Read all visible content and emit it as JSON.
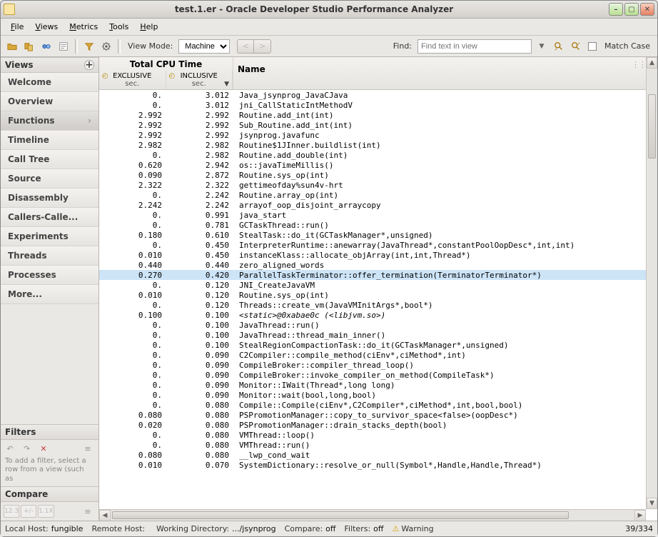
{
  "window": {
    "title": "test.1.er  -  Oracle Developer Studio Performance Analyzer"
  },
  "menu": {
    "file": "File",
    "views": "Views",
    "metrics": "Metrics",
    "tools": "Tools",
    "help": "Help"
  },
  "toolbar": {
    "view_mode_label": "View Mode:",
    "view_mode_value": "Machine",
    "find_label": "Find:",
    "find_placeholder": "Find text in view",
    "match_case_label": "Match Case"
  },
  "sidebar": {
    "views_header": "Views",
    "items": [
      {
        "label": "Welcome"
      },
      {
        "label": "Overview"
      },
      {
        "label": "Functions",
        "active": true
      },
      {
        "label": "Timeline"
      },
      {
        "label": "Call Tree"
      },
      {
        "label": "Source"
      },
      {
        "label": "Disassembly"
      },
      {
        "label": "Callers-Calle..."
      },
      {
        "label": "Experiments"
      },
      {
        "label": "Threads"
      },
      {
        "label": "Processes"
      },
      {
        "label": "More..."
      }
    ],
    "filters_header": "Filters",
    "filters_help": "To add a filter, select a row from a view (such as",
    "compare_header": "Compare"
  },
  "table": {
    "group_header": "Total CPU Time",
    "exclusive": "EXCLUSIVE",
    "inclusive": "INCLUSIVE",
    "sec": "sec.",
    "name": "Name",
    "rows": [
      {
        "ex": "0.",
        "in": "3.012",
        "fn": "Java_jsynprog_JavaCJava"
      },
      {
        "ex": "0.",
        "in": "3.012",
        "fn": "jni_CallStaticIntMethodV"
      },
      {
        "ex": "2.992",
        "in": "2.992",
        "fn": "Routine.add_int(int)"
      },
      {
        "ex": "2.992",
        "in": "2.992",
        "fn": "Sub_Routine.add_int(int)"
      },
      {
        "ex": "2.992",
        "in": "2.992",
        "fn": "jsynprog.javafunc"
      },
      {
        "ex": "2.982",
        "in": "2.982",
        "fn": "Routine$1JInner.buildlist(int)"
      },
      {
        "ex": "0.",
        "in": "2.982",
        "fn": "Routine.add_double(int)"
      },
      {
        "ex": "0.620",
        "in": "2.942",
        "fn": "os::javaTimeMillis()"
      },
      {
        "ex": "0.090",
        "in": "2.872",
        "fn": "Routine.sys_op(int)"
      },
      {
        "ex": "2.322",
        "in": "2.322",
        "fn": "gettimeofday%sun4v-hrt"
      },
      {
        "ex": "0.",
        "in": "2.242",
        "fn": "Routine.array_op(int)"
      },
      {
        "ex": "2.242",
        "in": "2.242",
        "fn": "arrayof_oop_disjoint_arraycopy"
      },
      {
        "ex": "0.",
        "in": "0.991",
        "fn": "java_start"
      },
      {
        "ex": "0.",
        "in": "0.781",
        "fn": "GCTaskThread::run()"
      },
      {
        "ex": "0.180",
        "in": "0.610",
        "fn": "StealTask::do_it(GCTaskManager*,unsigned)"
      },
      {
        "ex": "0.",
        "in": "0.450",
        "fn": "InterpreterRuntime::anewarray(JavaThread*,constantPoolOopDesc*,int,int)"
      },
      {
        "ex": "0.010",
        "in": "0.450",
        "fn": "instanceKlass::allocate_objArray(int,int,Thread*)"
      },
      {
        "ex": "0.440",
        "in": "0.440",
        "fn": "zero_aligned_words"
      },
      {
        "ex": "0.270",
        "in": "0.420",
        "fn": "ParallelTaskTerminator::offer_termination(TerminatorTerminator*)",
        "sel": true
      },
      {
        "ex": "0.",
        "in": "0.120",
        "fn": "JNI_CreateJavaVM"
      },
      {
        "ex": "0.010",
        "in": "0.120",
        "fn": "Routine.sys_op(int)"
      },
      {
        "ex": "0.",
        "in": "0.120",
        "fn": "Threads::create_vm(JavaVMInitArgs*,bool*)"
      },
      {
        "ex": "0.100",
        "in": "0.100",
        "fn": "<static>@0xabae0c (<libjvm.so>)",
        "italic": true
      },
      {
        "ex": "0.",
        "in": "0.100",
        "fn": "JavaThread::run()"
      },
      {
        "ex": "0.",
        "in": "0.100",
        "fn": "JavaThread::thread_main_inner()"
      },
      {
        "ex": "0.",
        "in": "0.100",
        "fn": "StealRegionCompactionTask::do_it(GCTaskManager*,unsigned)"
      },
      {
        "ex": "0.",
        "in": "0.090",
        "fn": "C2Compiler::compile_method(ciEnv*,ciMethod*,int)"
      },
      {
        "ex": "0.",
        "in": "0.090",
        "fn": "CompileBroker::compiler_thread_loop()"
      },
      {
        "ex": "0.",
        "in": "0.090",
        "fn": "CompileBroker::invoke_compiler_on_method(CompileTask*)"
      },
      {
        "ex": "0.",
        "in": "0.090",
        "fn": "Monitor::IWait(Thread*,long long)"
      },
      {
        "ex": "0.",
        "in": "0.090",
        "fn": "Monitor::wait(bool,long,bool)"
      },
      {
        "ex": "0.",
        "in": "0.080",
        "fn": "Compile::Compile(ciEnv*,C2Compiler*,ciMethod*,int,bool,bool)"
      },
      {
        "ex": "0.080",
        "in": "0.080",
        "fn": "PSPromotionManager::copy_to_survivor_space<false>(oopDesc*)"
      },
      {
        "ex": "0.020",
        "in": "0.080",
        "fn": "PSPromotionManager::drain_stacks_depth(bool)"
      },
      {
        "ex": "0.",
        "in": "0.080",
        "fn": "VMThread::loop()"
      },
      {
        "ex": "0.",
        "in": "0.080",
        "fn": "VMThread::run()"
      },
      {
        "ex": "0.080",
        "in": "0.080",
        "fn": "__lwp_cond_wait"
      },
      {
        "ex": "0.010",
        "in": "0.070",
        "fn": "SystemDictionary::resolve_or_null(Symbol*,Handle,Handle,Thread*)"
      }
    ]
  },
  "status": {
    "local_host_label": "Local Host:",
    "local_host_value": "fungible",
    "remote_host_label": "Remote Host:",
    "remote_host_value": "",
    "workdir_label": "Working Directory:",
    "workdir_value": ".../jsynprog",
    "compare_label": "Compare:",
    "compare_value": "off",
    "filters_label": "Filters:",
    "filters_value": "off",
    "warning": "Warning",
    "rowpos": "39/334"
  }
}
